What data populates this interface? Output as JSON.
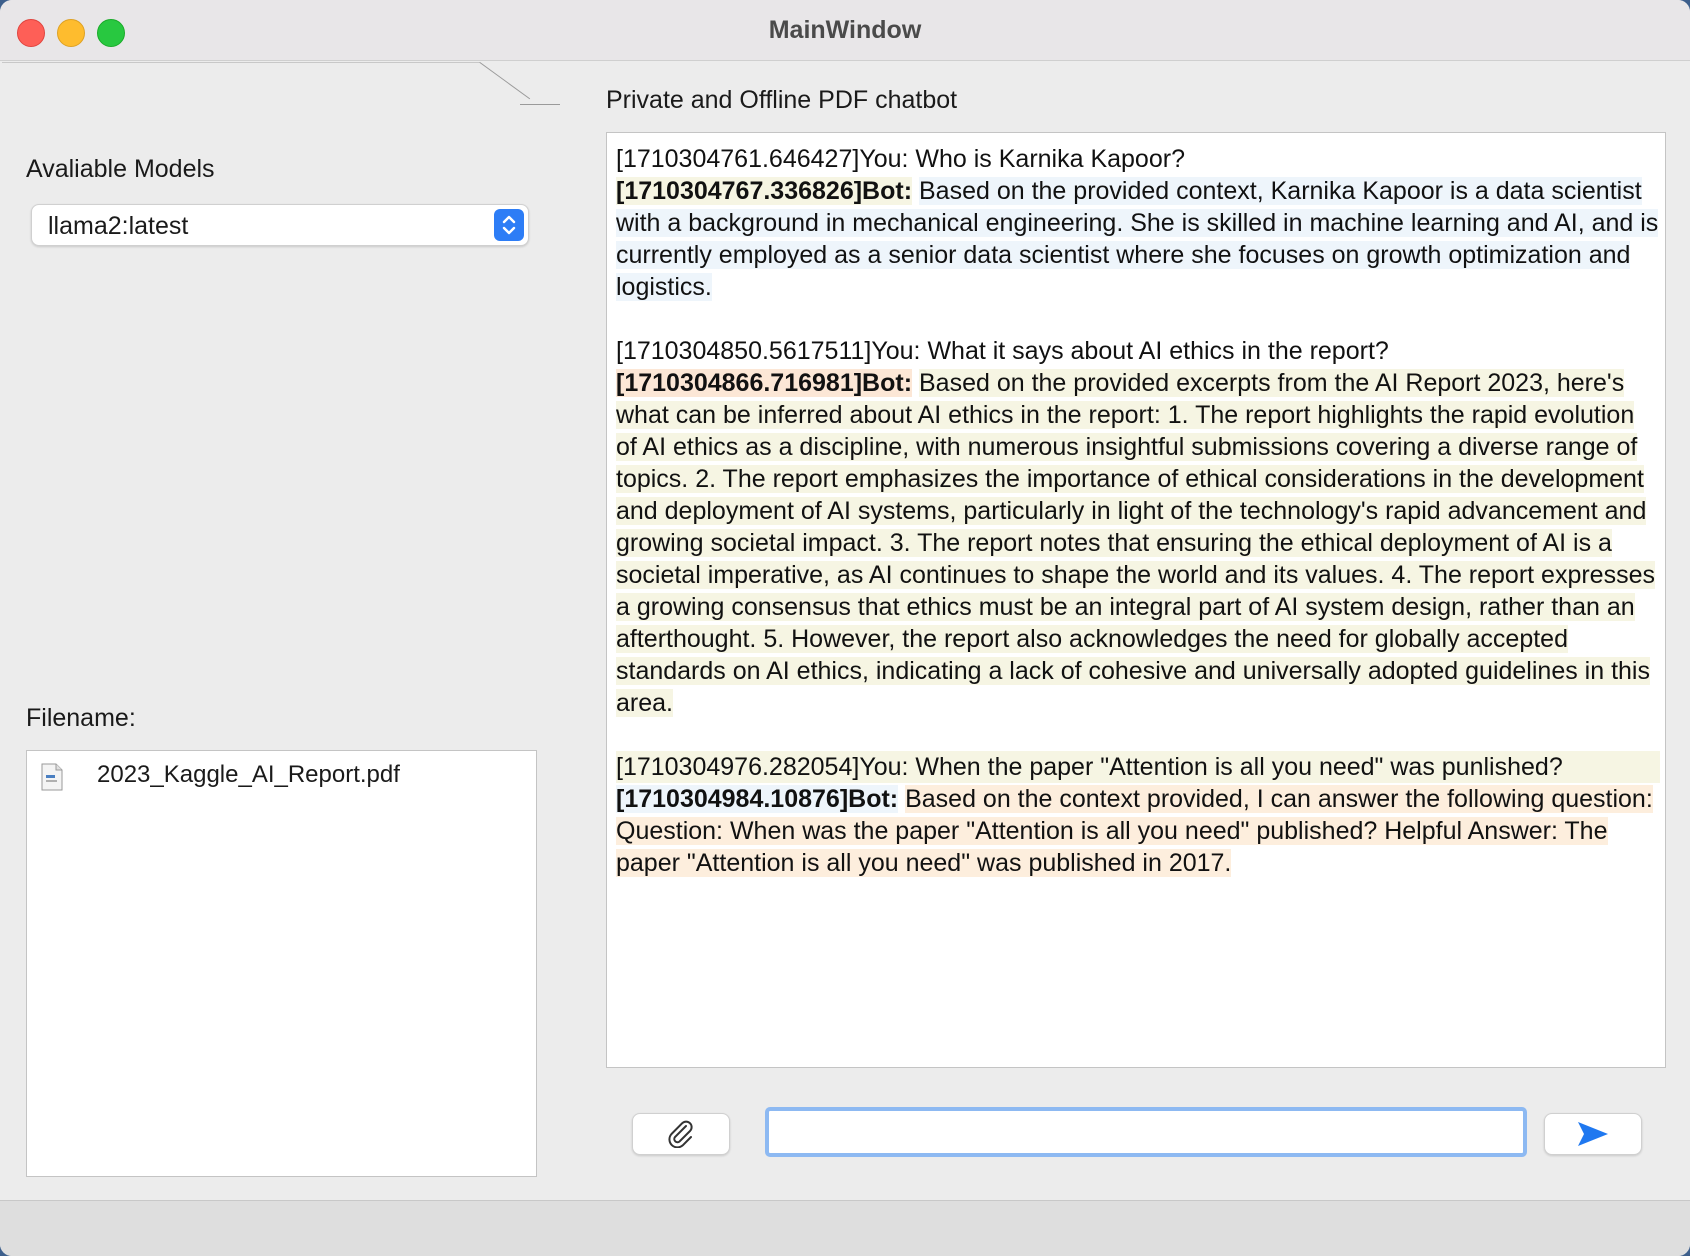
{
  "window": {
    "title": "MainWindow"
  },
  "sidebar": {
    "models_label": "Avaliable Models",
    "selected_model": "llama2:latest",
    "filename_label": "Filename:",
    "files": [
      "2023_Kaggle_AI_Report.pdf"
    ]
  },
  "main": {
    "heading": "Private and Offline PDF chatbot",
    "messages": [
      {
        "you_ts": "[1710304761.646427]",
        "you_text": "You: Who is Karnika Kapoor?",
        "bot_ts": "[1710304767.336826]Bot:",
        "bot_text": "Based on the provided context, Karnika Kapoor is a data scientist with a background in mechanical engineering. She is skilled in machine learning and AI, and is currently employed as a senior data scientist where she focuses on growth optimization and logistics."
      },
      {
        "you_ts": "[1710304850.5617511]",
        "you_text": "You: What it says about AI ethics in the report?",
        "bot_ts": "[1710304866.716981]Bot:",
        "bot_text": "Based on the provided excerpts from the AI Report 2023, here's what can be inferred about AI ethics in the report: 1. The report highlights the rapid evolution of AI ethics as a discipline, with numerous insightful submissions covering a diverse range of topics. 2. The report emphasizes the importance of ethical considerations in the development and deployment of AI systems, particularly in light of the technology's rapid advancement and growing societal impact. 3. The report notes that ensuring the ethical deployment of AI is a societal imperative, as AI continues to shape the world and its values. 4. The report expresses a growing consensus that ethics must be an integral part of AI system design, rather than an afterthought. 5. However, the report also acknowledges the need for globally accepted standards on AI ethics, indicating a lack of cohesive and universally adopted guidelines in this area."
      },
      {
        "you_ts": "[1710304976.282054]",
        "you_text": "You: When the paper \"Attention is all you need\" was punlished?",
        "bot_ts": "[1710304984.10876]Bot:",
        "bot_text": "Based on the context provided, I can answer the following question: Question: When was the paper \"Attention is all you need\" published? Helpful Answer: The paper \"Attention is all you need\" was published in 2017."
      }
    ]
  },
  "input": {
    "value": "",
    "placeholder": ""
  },
  "icons": {
    "attach": "paperclip-icon",
    "send": "send-arrow-icon",
    "file": "pdf-file-icon"
  },
  "colors": {
    "accent": "#2d7df6",
    "focus_ring": "#8db9f2"
  }
}
